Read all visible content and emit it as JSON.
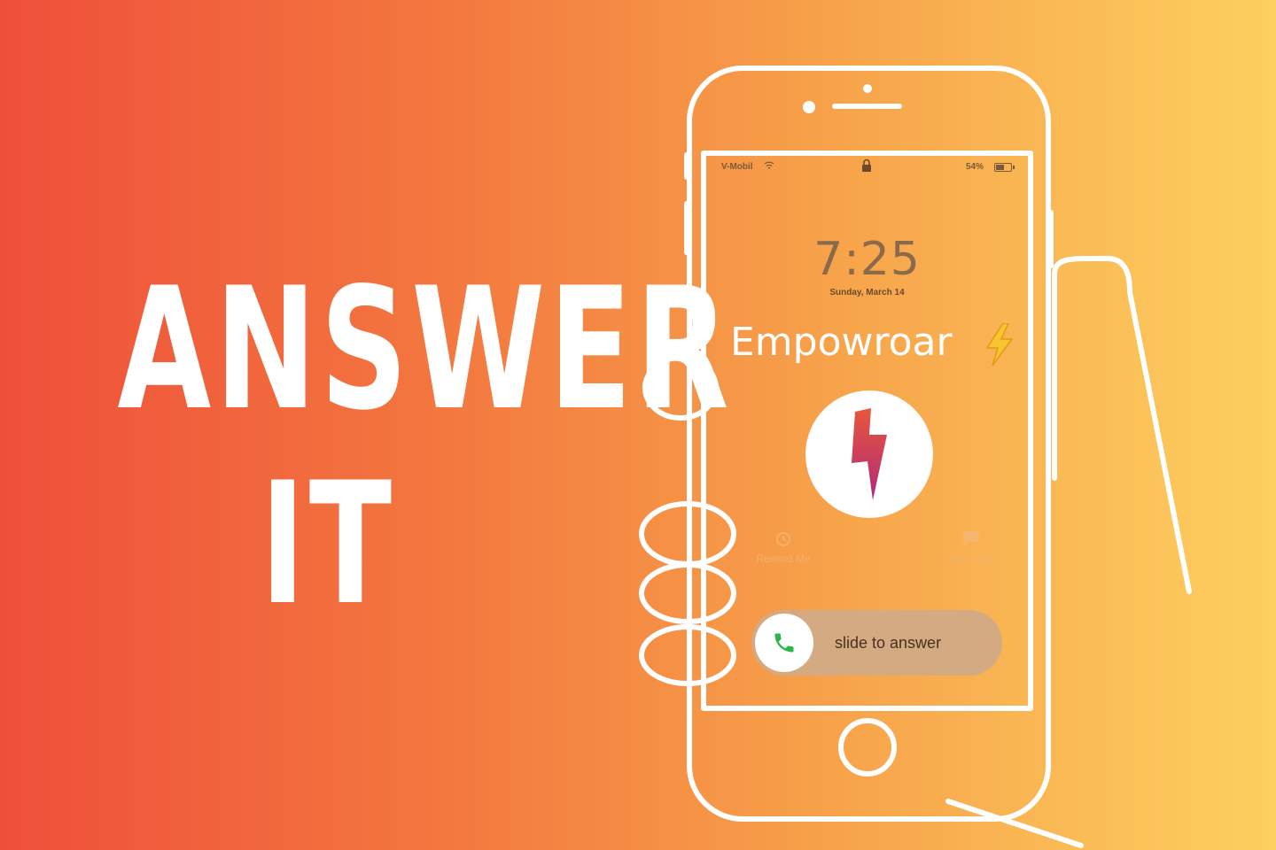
{
  "headline": {
    "line1": "ANSWER",
    "line2": "IT"
  },
  "phone": {
    "status": {
      "carrier": "V-Mobil",
      "battery_text": "54%",
      "battery_level": 0.54
    },
    "time": "7:25",
    "date": "Sunday, March 14",
    "caller_name": "Empowroar",
    "caller_emoji": "lightning-emoji",
    "actions": {
      "remind": "Remind Me",
      "message": "Message"
    },
    "slide_label": "slide to answer"
  },
  "colors": {
    "accent_green": "#2bb64a",
    "bolt_top": "#e8563a",
    "bolt_bottom": "#b12a7c"
  }
}
